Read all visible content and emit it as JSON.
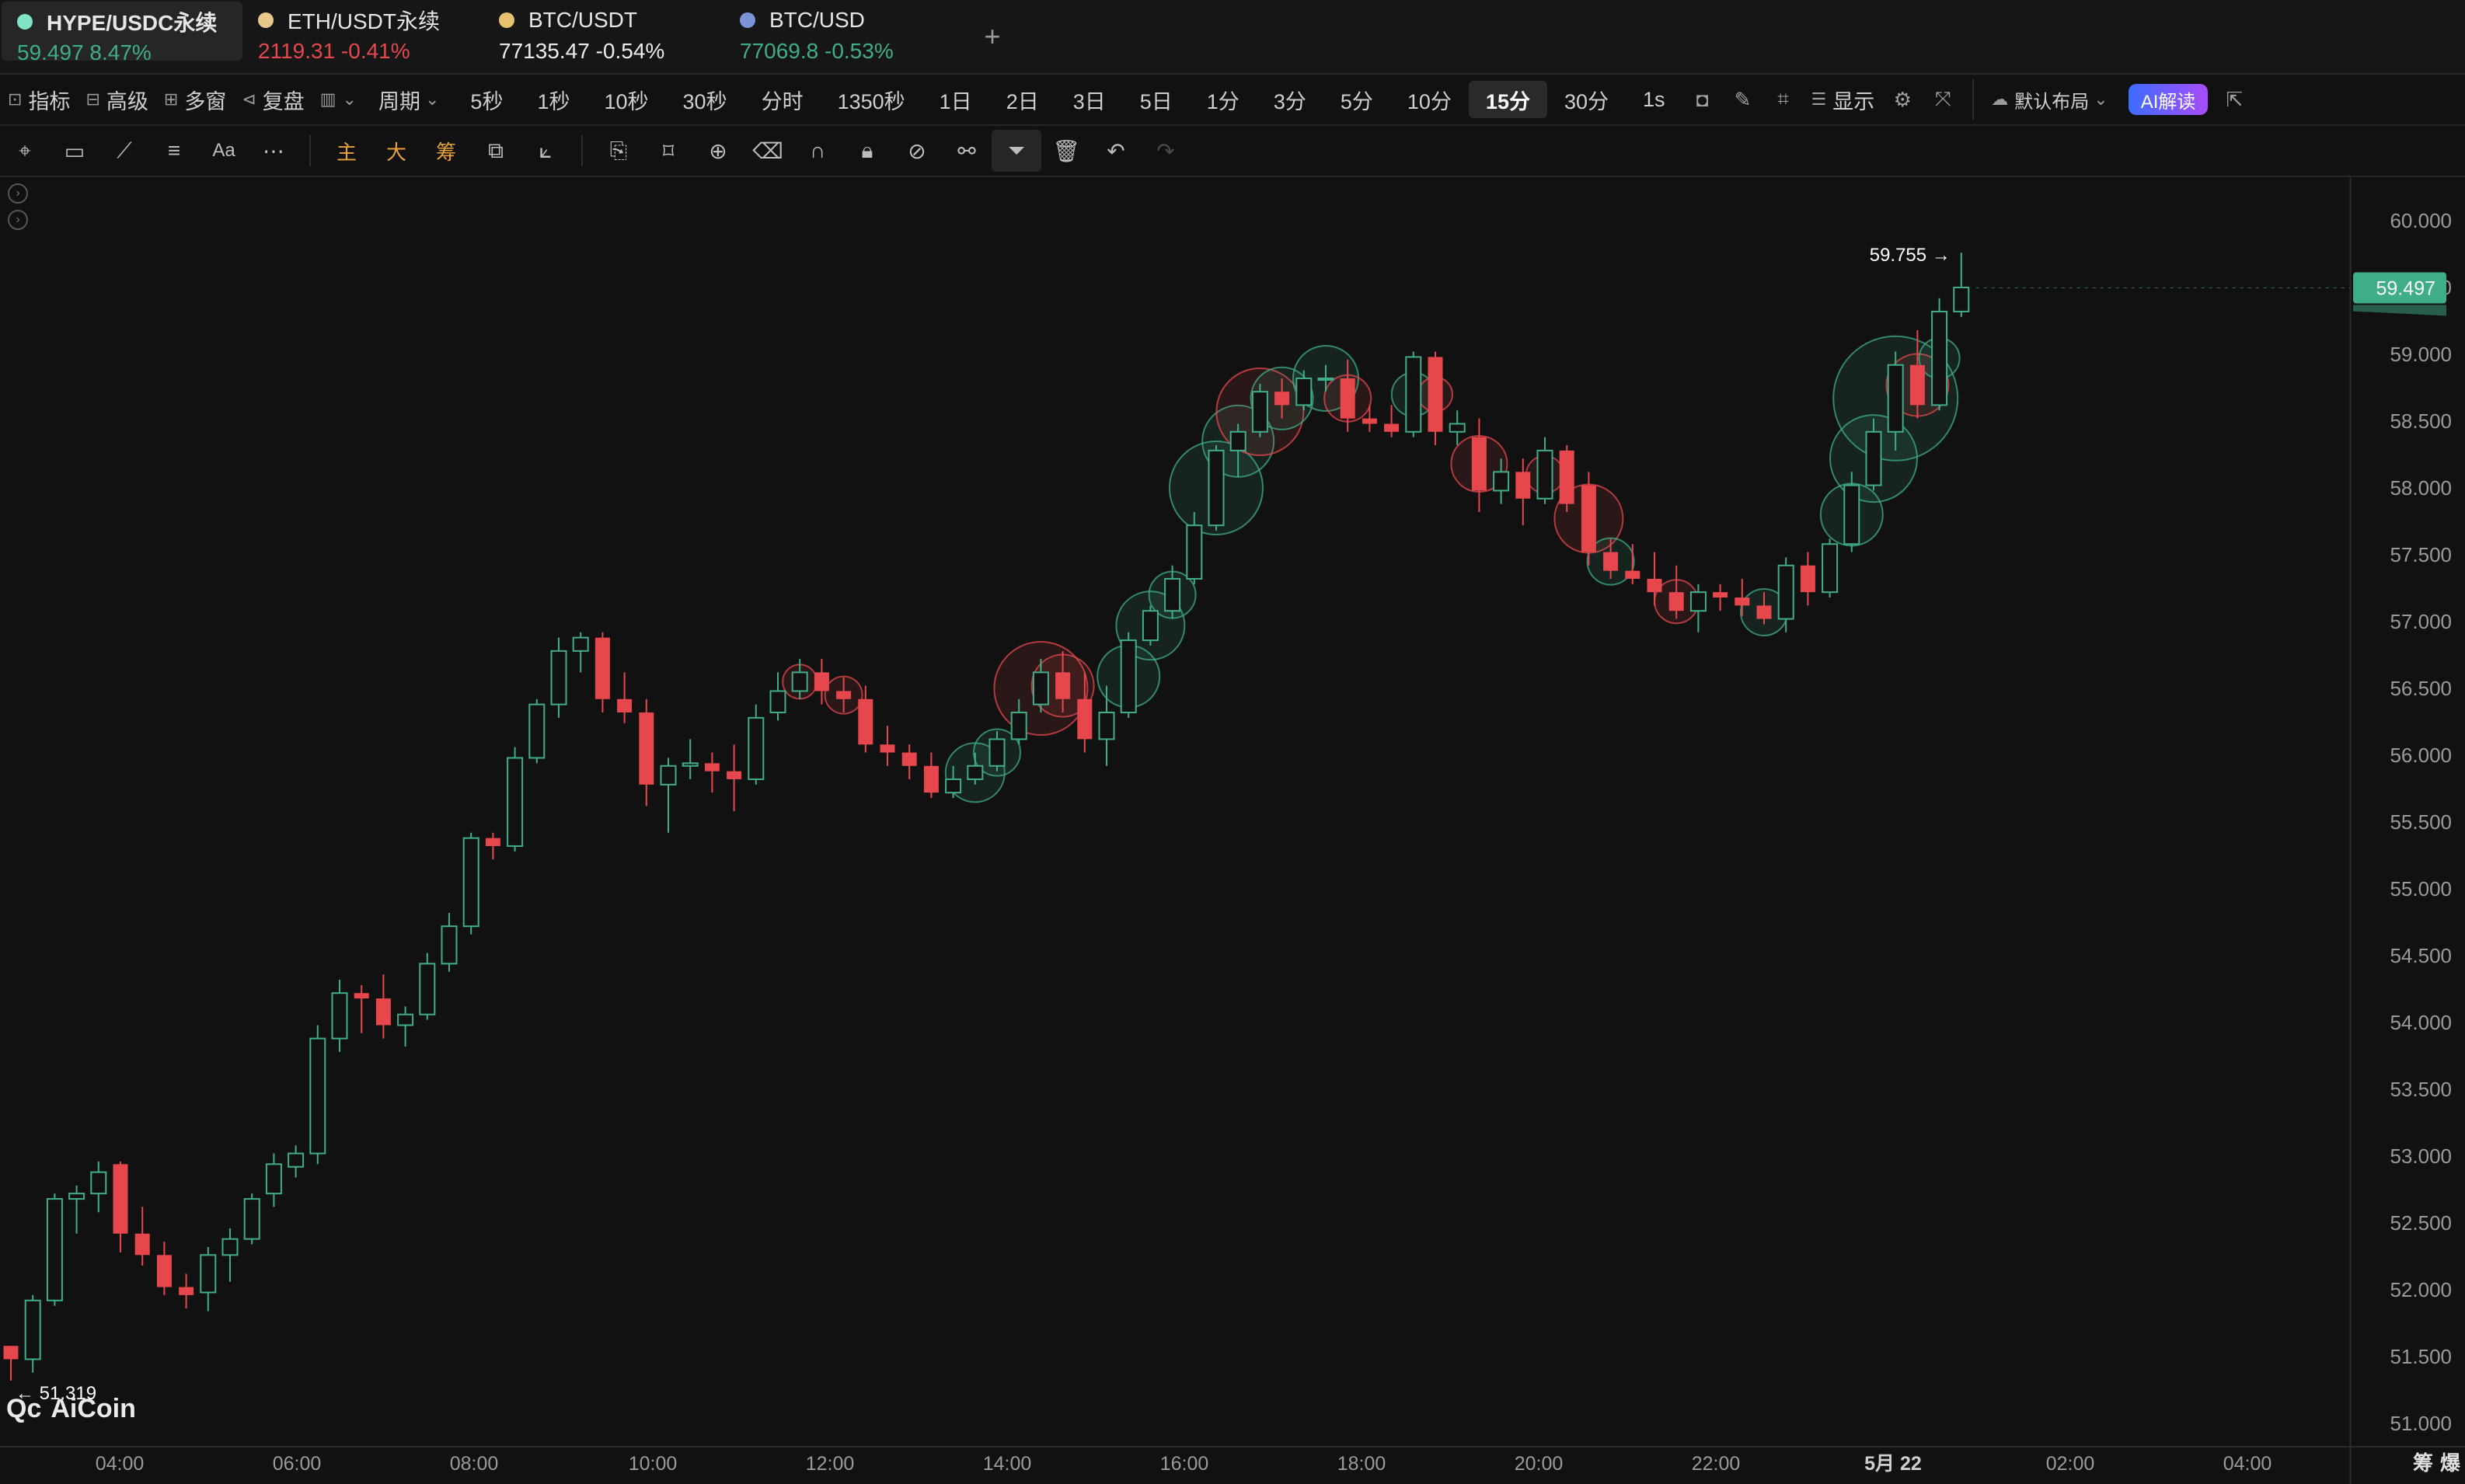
{
  "tickers": [
    {
      "name": "HYPE/USDC永续",
      "price": "59.497",
      "change": "8.47%",
      "trend": "up",
      "dot_color": "#7fe3c7"
    },
    {
      "name": "ETH/USDT永续",
      "price": "2119.31",
      "change": "-0.41%",
      "trend": "down",
      "dot_color": "#e9c88a"
    },
    {
      "name": "BTC/USDT",
      "price": "77135.47",
      "change": "-0.54%",
      "trend": "white",
      "dot_color": "#e8c170"
    },
    {
      "name": "BTC/USD",
      "price": "77069.8",
      "change": "-0.53%",
      "trend": "up",
      "dot_color": "#7d93d8"
    }
  ],
  "add_tab_label": "+",
  "period_bar": {
    "indicator": "指标",
    "advanced": "高级",
    "multi_window": "多窗",
    "replay": "复盘",
    "cycle": "周期",
    "periods": [
      "5秒",
      "1秒",
      "10秒",
      "30秒",
      "分时",
      "1350秒",
      "1日",
      "2日",
      "3日",
      "5日",
      "1分",
      "3分",
      "5分",
      "10分",
      "15分",
      "30分"
    ],
    "active_period": "15分",
    "extra_period": "1s",
    "display": "显示",
    "default_layout": "默认布局",
    "ai_button": "AI解读"
  },
  "draw_bar": {
    "main": "主",
    "big": "大",
    "chip": "筹",
    "text_tool": "Aa"
  },
  "chart_data": {
    "type": "candlestick",
    "symbol": "HYPE/USDC永续",
    "ylim": [
      51.0,
      60.0
    ],
    "y_ticks": [
      "60.000",
      "59.500",
      "59.000",
      "58.500",
      "58.000",
      "57.500",
      "57.000",
      "56.500",
      "56.000",
      "55.500",
      "55.000",
      "54.500",
      "54.000",
      "53.500",
      "53.000",
      "52.500",
      "52.000",
      "51.500",
      "51.000"
    ],
    "x_ticks": [
      "04:00",
      "06:00",
      "08:00",
      "10:00",
      "12:00",
      "14:00",
      "16:00",
      "18:00",
      "20:00",
      "22:00",
      "5月 22",
      "02:00",
      "04:00"
    ],
    "current_price": "59.497",
    "high_label": "59.755",
    "low_label": "51.319",
    "up_color": "#3fae88",
    "down_color": "#e5474d",
    "candles": [
      [
        51.58,
        51.58,
        51.32,
        51.48
      ],
      [
        51.48,
        51.96,
        51.38,
        51.92
      ],
      [
        51.92,
        52.72,
        51.88,
        52.68
      ],
      [
        52.68,
        52.78,
        52.42,
        52.72
      ],
      [
        52.72,
        52.96,
        52.58,
        52.88
      ],
      [
        52.94,
        52.96,
        52.28,
        52.42
      ],
      [
        52.42,
        52.62,
        52.18,
        52.26
      ],
      [
        52.26,
        52.36,
        51.96,
        52.02
      ],
      [
        52.02,
        52.12,
        51.86,
        51.96
      ],
      [
        51.98,
        52.32,
        51.84,
        52.26
      ],
      [
        52.26,
        52.46,
        52.06,
        52.38
      ],
      [
        52.38,
        52.72,
        52.34,
        52.68
      ],
      [
        52.72,
        53.02,
        52.62,
        52.94
      ],
      [
        52.92,
        53.08,
        52.84,
        53.02
      ],
      [
        53.02,
        53.98,
        52.94,
        53.88
      ],
      [
        53.88,
        54.32,
        53.78,
        54.22
      ],
      [
        54.22,
        54.28,
        53.92,
        54.18
      ],
      [
        54.18,
        54.36,
        53.88,
        53.98
      ],
      [
        53.98,
        54.12,
        53.82,
        54.06
      ],
      [
        54.06,
        54.52,
        54.02,
        54.44
      ],
      [
        54.44,
        54.82,
        54.38,
        54.72
      ],
      [
        54.72,
        55.42,
        54.66,
        55.38
      ],
      [
        55.38,
        55.42,
        55.22,
        55.32
      ],
      [
        55.32,
        56.06,
        55.28,
        55.98
      ],
      [
        55.98,
        56.42,
        55.94,
        56.38
      ],
      [
        56.38,
        56.88,
        56.28,
        56.78
      ],
      [
        56.78,
        56.92,
        56.62,
        56.88
      ],
      [
        56.88,
        56.92,
        56.32,
        56.42
      ],
      [
        56.42,
        56.62,
        56.24,
        56.32
      ],
      [
        56.32,
        56.42,
        55.62,
        55.78
      ],
      [
        55.78,
        55.98,
        55.42,
        55.92
      ],
      [
        55.92,
        56.12,
        55.82,
        55.94
      ],
      [
        55.94,
        56.02,
        55.72,
        55.88
      ],
      [
        55.88,
        56.08,
        55.58,
        55.82
      ],
      [
        55.82,
        56.38,
        55.78,
        56.28
      ],
      [
        56.32,
        56.62,
        56.26,
        56.48
      ],
      [
        56.48,
        56.72,
        56.42,
        56.62
      ],
      [
        56.62,
        56.72,
        56.38,
        56.48
      ],
      [
        56.48,
        56.58,
        56.32,
        56.42
      ],
      [
        56.42,
        56.52,
        56.02,
        56.08
      ],
      [
        56.08,
        56.22,
        55.92,
        56.02
      ],
      [
        56.02,
        56.08,
        55.82,
        55.92
      ],
      [
        55.92,
        56.02,
        55.68,
        55.72
      ],
      [
        55.72,
        55.92,
        55.68,
        55.82
      ],
      [
        55.82,
        56.02,
        55.78,
        55.92
      ],
      [
        55.92,
        56.18,
        55.88,
        56.12
      ],
      [
        56.12,
        56.42,
        56.08,
        56.32
      ],
      [
        56.38,
        56.72,
        56.32,
        56.62
      ],
      [
        56.62,
        56.78,
        56.32,
        56.42
      ],
      [
        56.42,
        56.62,
        56.02,
        56.12
      ],
      [
        56.12,
        56.52,
        55.92,
        56.32
      ],
      [
        56.32,
        56.92,
        56.28,
        56.86
      ],
      [
        56.86,
        57.12,
        56.82,
        57.08
      ],
      [
        57.08,
        57.42,
        57.02,
        57.32
      ],
      [
        57.32,
        57.82,
        57.28,
        57.72
      ],
      [
        57.72,
        58.32,
        57.68,
        58.28
      ],
      [
        58.28,
        58.48,
        58.08,
        58.42
      ],
      [
        58.42,
        58.78,
        58.38,
        58.72
      ],
      [
        58.72,
        58.82,
        58.52,
        58.62
      ],
      [
        58.62,
        58.88,
        58.58,
        58.82
      ],
      [
        58.82,
        58.92,
        58.72,
        58.82
      ],
      [
        58.82,
        58.96,
        58.42,
        58.52
      ],
      [
        58.52,
        58.62,
        58.42,
        58.48
      ],
      [
        58.48,
        58.62,
        58.38,
        58.42
      ],
      [
        58.42,
        59.02,
        58.38,
        58.98
      ],
      [
        58.98,
        59.02,
        58.32,
        58.42
      ],
      [
        58.42,
        58.58,
        58.32,
        58.48
      ],
      [
        58.38,
        58.52,
        57.82,
        57.98
      ],
      [
        57.98,
        58.22,
        57.88,
        58.12
      ],
      [
        58.12,
        58.22,
        57.72,
        57.92
      ],
      [
        57.92,
        58.38,
        57.88,
        58.28
      ],
      [
        58.28,
        58.32,
        57.82,
        57.88
      ],
      [
        58.02,
        58.12,
        57.42,
        57.52
      ],
      [
        57.52,
        57.62,
        57.32,
        57.38
      ],
      [
        57.38,
        57.58,
        57.28,
        57.32
      ],
      [
        57.32,
        57.52,
        57.12,
        57.22
      ],
      [
        57.22,
        57.42,
        57.02,
        57.08
      ],
      [
        57.08,
        57.28,
        56.92,
        57.22
      ],
      [
        57.22,
        57.28,
        57.08,
        57.18
      ],
      [
        57.18,
        57.32,
        57.04,
        57.12
      ],
      [
        57.12,
        57.22,
        56.98,
        57.02
      ],
      [
        57.02,
        57.48,
        56.92,
        57.42
      ],
      [
        57.42,
        57.52,
        57.12,
        57.22
      ],
      [
        57.22,
        57.62,
        57.18,
        57.58
      ],
      [
        57.58,
        58.12,
        57.52,
        58.02
      ],
      [
        58.02,
        58.52,
        57.98,
        58.42
      ],
      [
        58.42,
        59.02,
        58.28,
        58.92
      ],
      [
        58.92,
        59.18,
        58.52,
        58.62
      ],
      [
        58.62,
        59.42,
        58.58,
        59.32
      ],
      [
        59.32,
        59.76,
        59.28,
        59.5
      ]
    ]
  }
}
